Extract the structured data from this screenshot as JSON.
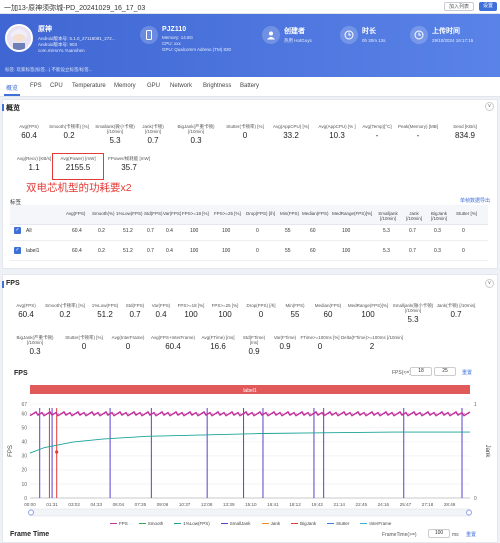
{
  "window": {
    "title": "一加13-原神须弥城-PD_20241029_16_17_03",
    "invite_label": "加入列表",
    "settings_label": "设置"
  },
  "app": {
    "name": "原神",
    "lines": [
      "Android版本号: 5.1.0_27118081_272...",
      "Android版本号: 903",
      "com.miHoYo.Yuanshen"
    ]
  },
  "device": {
    "title": "PJZ110",
    "lines": [
      "Memory: 14.8G",
      "CPU: xxx",
      "GPU: Qualcomm Adreno (TM) 830"
    ]
  },
  "creator": {
    "title": "创建者",
    "sub": "热用 HotGuys"
  },
  "duration": {
    "title": "时长",
    "sub": "0h 30m 13s"
  },
  "upload": {
    "title": "上传时间",
    "sub": "29/10/2024 16:17:15"
  },
  "tags_text": "标签:  玩家标签(标签...)  不能设立标签/标签...",
  "tabs": [
    "概览",
    "FPS",
    "CPU",
    "Temperature",
    "Memory",
    "GPU",
    "Network",
    "Brightness",
    "Battery"
  ],
  "overview": {
    "title": "概览",
    "collapse_glyph": "∨",
    "stats": [
      {
        "label": "Avg(FPS)",
        "value": "60.4"
      },
      {
        "label": "Smooth(卡顿率) [%]",
        "value": "0.2"
      },
      {
        "label": "Smallank(微小卡顿) [/10min]",
        "value": "5.3"
      },
      {
        "label": "Jank(卡顿) [/10min]",
        "value": "0.7"
      },
      {
        "label": "BigJank(严重卡顿) [/10min]",
        "value": "0.3"
      },
      {
        "label": "Stutter(卡顿率) [%]",
        "value": "0"
      },
      {
        "label": "Avg(AppCPU) [%]",
        "value": "33.2"
      },
      {
        "label": "Avg(AppCPU) [% ]",
        "value": "10.3"
      },
      {
        "label": "Avg(Temp)[°C]",
        "value": "-"
      },
      {
        "label": "Peak(Memory) [MB]",
        "value": "-"
      },
      {
        "label": "Send [KB/s]",
        "value": "834.9"
      }
    ],
    "stats2": [
      {
        "label": "Avg(Recv) [KB/s]",
        "value": "1.1"
      },
      {
        "label": "Avg(Power) [mW]",
        "value": "2155.5"
      },
      {
        "label": "FPower/帧耗能 [mW]",
        "value": "35.7"
      }
    ],
    "annotation": "双电芯机型的功耗要x2",
    "table_title": "标签",
    "table_link": "单帧数据导出",
    "table_headers": [
      "Avg(FPS)",
      "Smooth(%)",
      "1%Low(FPS)",
      "Std(FPS)",
      "Var(FPS)",
      "FPS>=18 [%]",
      "FPS>=25 [%]",
      "Drop(FPS) [/h]",
      "Min(FPS)",
      "Median(FPS)",
      "MedRange(FPS)[%]",
      "Smalljank [/10min]",
      "Jank [/10min]",
      "BigJank [/10min]",
      "Stutter [%]"
    ],
    "rows": [
      {
        "label": "All",
        "cells": [
          "60.4",
          "0.2",
          "51.2",
          "0.7",
          "0.4",
          "100",
          "100",
          "0",
          "55",
          "60",
          "100",
          "5.3",
          "0.7",
          "0.3",
          "0"
        ]
      },
      {
        "label": "label1",
        "cells": [
          "60.4",
          "0.2",
          "51.2",
          "0.7",
          "0.4",
          "100",
          "100",
          "0",
          "55",
          "60",
          "100",
          "5.3",
          "0.7",
          "0.3",
          "0"
        ]
      }
    ]
  },
  "fps_section": {
    "title": "FPS",
    "stats_row1": [
      {
        "label": "Avg(FPS)",
        "value": "60.4"
      },
      {
        "label": "Smooth(卡顿率) [%]",
        "value": "0.2"
      },
      {
        "label": "1%Low(FPS)",
        "value": "51.2"
      },
      {
        "label": "Std(FPS)",
        "value": "0.7"
      },
      {
        "label": "Var(FPS)",
        "value": "0.4"
      },
      {
        "label": "FPS>=18 [%]",
        "value": "100"
      },
      {
        "label": "FPS>=25 [%]",
        "value": "100"
      },
      {
        "label": "Drop(FPS) [/h]",
        "value": "0"
      },
      {
        "label": "Min(FPS)",
        "value": "55"
      },
      {
        "label": "Median(FPS)",
        "value": "60"
      },
      {
        "label": "MedRange(FPS)[%]",
        "value": "100"
      },
      {
        "label": "Smalljank(微小卡顿) [/10min]",
        "value": "5.3"
      },
      {
        "label": "Jank(卡顿) [/10min]",
        "value": "0.7"
      }
    ],
    "stats_row2": [
      {
        "label": "BigJank(严重卡顿) [/10min]",
        "value": "0.3"
      },
      {
        "label": "Stutter(卡顿率) [%]",
        "value": "0"
      },
      {
        "label": "Avg(InterFrame)",
        "value": "0"
      },
      {
        "label": "Avg(FPS+InterFrame)",
        "value": "60.4"
      },
      {
        "label": "Avg(FTime) [ms]",
        "value": "16.6"
      },
      {
        "label": "Std(FTime) [ms]",
        "value": "0.9"
      },
      {
        "label": "Var(FTime)",
        "value": "0.9"
      },
      {
        "label": "FTime>=100ms [%]",
        "value": "0"
      },
      {
        "label": "Delta(FTime)>=100ms [/10min]",
        "value": "2"
      }
    ]
  },
  "fps_chart_title": "FPS",
  "fps_threshold": {
    "label": "FPS(<=)",
    "v1": "18",
    "v2": "25",
    "reset": "重置"
  },
  "frame_time": {
    "title": "Frame Time",
    "label": "FrameTime(>=)",
    "value": "100",
    "unit": "ms",
    "reset": "重置"
  },
  "colors": {
    "accent": "#3f6fd8",
    "fps": "#c2339c",
    "smooth": "#2ea44f",
    "low": "#1aa39a",
    "smalljank": "#5b3fcf",
    "jank": "#f08a24",
    "bigjank": "#e53935",
    "stutter": "#3a7bd5",
    "interframe": "#35b6d6"
  },
  "chart_data": {
    "type": "line",
    "title": "FPS",
    "label_bar": "label1",
    "xlabel": "",
    "ylabel": "FPS",
    "y2label": "Jank",
    "yticks": [
      67,
      60,
      50,
      40,
      30,
      20,
      10,
      0
    ],
    "y2ticks": [
      1,
      0
    ],
    "xticks": [
      "00:00",
      "01:31",
      "03:02",
      "04:33",
      "06:04",
      "07:35",
      "09:06",
      "10:37",
      "12:08",
      "13:39",
      "15:10",
      "16:41",
      "18:12",
      "19:43",
      "21:14",
      "22:45",
      "24:16",
      "25:47",
      "27:18",
      "28:49"
    ],
    "ylim": [
      0,
      67
    ],
    "legend": [
      "FPS",
      "Smooth",
      "1%Low(FPS)",
      "SmallJank",
      "Jank",
      "BigJank",
      "Stutter",
      "InterFrame"
    ],
    "legend_position": "bottom",
    "series": [
      {
        "name": "FPS",
        "x": [
          "00:00",
          "05:00",
          "10:00",
          "15:00",
          "20:00",
          "25:00",
          "30:13"
        ],
        "values": [
          60,
          60,
          60,
          60,
          60,
          60,
          60
        ]
      },
      {
        "name": "1%Low(FPS)",
        "x": [
          "00:00",
          "01:00",
          "03:00",
          "05:00",
          "08:00",
          "12:00",
          "16:00",
          "20:00",
          "25:00",
          "30:13"
        ],
        "values": [
          32,
          36,
          40,
          42,
          44,
          45,
          46,
          46.5,
          47,
          47
        ]
      },
      {
        "name": "SmallJank",
        "x": [
          "00:40",
          "01:31",
          "05:30",
          "08:20",
          "12:10",
          "14:40",
          "16:00",
          "19:30",
          "20:10",
          "25:40",
          "29:40"
        ],
        "values": [
          1,
          1,
          1,
          1,
          1,
          1,
          1,
          1,
          1,
          1,
          1
        ]
      },
      {
        "name": "BigJank",
        "x": [
          "01:20",
          "01:50"
        ],
        "values": [
          1,
          1
        ]
      }
    ]
  }
}
